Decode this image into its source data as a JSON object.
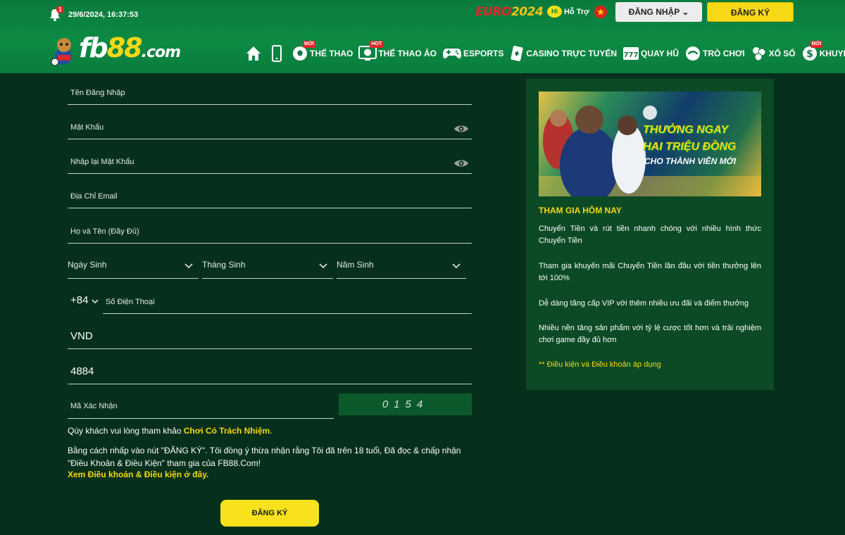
{
  "header": {
    "notification_count": "1",
    "datetime": "29/6/2024, 16:37:53",
    "euro_part1": "EURO",
    "euro_part2": "2024",
    "support_label": "Hỗ Trợ",
    "support_bubble": "Hi",
    "login_label": "ĐĂNG NHẬP",
    "register_label": "ĐĂNG KÝ",
    "logo_fb": "fb",
    "logo_88": "88",
    "logo_com": ".com"
  },
  "nav": {
    "items": [
      {
        "label": "",
        "icon": "home-icon"
      },
      {
        "label": "",
        "icon": "phone-icon"
      },
      {
        "label": "THỂ THAO",
        "icon": "soccer-ball-icon",
        "tag": "MỚI"
      },
      {
        "label": "THỂ THAO ẢO",
        "icon": "virtual-sports-icon",
        "tag": "HOT"
      },
      {
        "label": "ESPORTS",
        "icon": "gamepad-icon"
      },
      {
        "label": "CASINO TRỰC TUYẾN",
        "icon": "cards-icon"
      },
      {
        "label": "QUAY HŨ",
        "icon": "slot-777-icon"
      },
      {
        "label": "TRÒ CHƠI",
        "icon": "game-icon"
      },
      {
        "label": "XỔ SỐ",
        "icon": "lottery-icon"
      },
      {
        "label": "KHUYẾN MÃI",
        "icon": "dollar-icon",
        "tag": "MỚI"
      }
    ]
  },
  "form": {
    "username_label": "Tên Đăng Nhập",
    "password_label": "Mật Khẩu",
    "confirm_password_label": "Nhập lại Mật Khẩu",
    "email_label": "Địa Chỉ Email",
    "fullname_label": "Họ và Tên (Đầy Đủ)",
    "birth_day_label": "Ngày Sinh",
    "birth_month_label": "Tháng Sinh",
    "birth_year_label": "Năm Sinh",
    "phone_prefix": "+84",
    "phone_label": "Số Điện Thoại",
    "currency_value": "VND",
    "code_value": "4884",
    "captcha_label": "Mã Xác Nhận",
    "captcha_code": "0154",
    "note1_text": "Qúy khách vui lòng tham khảo ",
    "note1_link": "Chơi Có Trách Nhiệm",
    "note1_end": ".",
    "note2": "Bằng cách nhấp vào nút \"ĐĂNG KÝ\". Tôi đồng ý thừa nhận rằng Tôi đã trên 18 tuổi, Đã đọc & chấp nhận \"Điều Khoản & Điều Kiện\" tham gia của FB88.Com!",
    "note3_link": "Xem Điều khoản & Điều kiện ở đây.",
    "submit_label": "ĐĂNG KÝ"
  },
  "promo": {
    "banner_line1": "THƯỞNG NGAY",
    "banner_line2": "HAI TRIỆU ĐỒNG",
    "banner_line3": "CHO THÀNH VIÊN MỚI",
    "title": "THAM GIA HÔM NAY",
    "benefits": [
      "Chuyển Tiền và rút tiền nhanh chóng với nhiều hình thức Chuyển Tiền",
      "Tham gia khuyến mãi Chuyển Tiền lần đầu với tiền thưởng lên tới 100%",
      "Dễ dàng tăng cấp VIP với thêm nhiều ưu đãi và điểm thưởng",
      "Nhiều nền tảng sản phẩm với tỷ lệ cược tốt hơn và trải nghiệm chơi game đầy đủ hơn"
    ],
    "terms": "** Điều kiện và Điều khoản áp dụng"
  }
}
